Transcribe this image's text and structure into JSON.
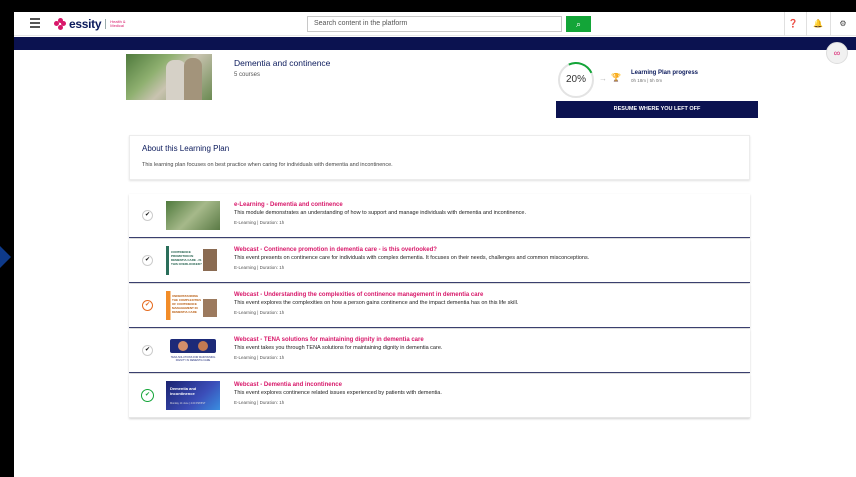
{
  "topbar": {
    "brand": "essity",
    "brand_sub": "Health & Medical",
    "search_placeholder": "Search content in the platform",
    "icons": [
      "hamburger-icon",
      "search-icon",
      "help-icon",
      "bell-icon",
      "gear-icon"
    ]
  },
  "plan": {
    "title": "Dementia and continence",
    "course_count": "5 courses",
    "progress_percent": "20%",
    "progress_fraction": 0.2,
    "progress_label": "Learning Plan progress",
    "progress_time": "0h 18m | 5h 0m",
    "resume_label": "RESUME WHERE YOU LEFT OFF"
  },
  "about": {
    "title": "About this Learning Plan",
    "text": "This learning plan focuses on best practice when caring for individuals with dementia and incontinence."
  },
  "courses": [
    {
      "title": "e-Learning - Dementia and continence",
      "desc": "This module demonstrates an understanding of how to support and manage individuals with dementia and incontinence.",
      "meta": "E-Learning  |  Duration: 1h",
      "status": "completed"
    },
    {
      "title": "Webcast - Continence promotion in dementia care - is this overlooked?",
      "desc": "This event presents on continence care for individuals with complex dementia. It focuses on their needs, challenges and common misconceptions.",
      "meta": "E-Learning  |  Duration: 1h",
      "status": "completed",
      "thumb_text": "CONTINENCE PROMOTION IN DEMENTIA CARE - IS THIS OVERLOOKED?"
    },
    {
      "title": "Webcast - Understanding the complexities of continence management in dementia care",
      "desc": "This event explores the complexities on how a person gains continence and the impact dementia has on this life skill.",
      "meta": "E-Learning  |  Duration: 1h",
      "status": "in-progress",
      "thumb_text": "UNDERSTANDING THE COMPLEXITIES OF CONTINENCE MANAGEMENT IN DEMENTIA CARE"
    },
    {
      "title": "Webcast - TENA solutions for maintaining dignity in dementia care",
      "desc": "This event takes you through TENA solutions for maintaining dignity in dementia care.",
      "meta": "E-Learning  |  Duration: 1h",
      "status": "completed",
      "thumb_text": "TENA SOLUTIONS FOR MAINTAINING DIGNITY IN DEMENTIA CARE"
    },
    {
      "title": "Webcast - Dementia and incontinence",
      "desc": "This event explores continence related issues experienced by patients with dementia.",
      "meta": "E-Learning  |  Duration: 1h",
      "status": "current",
      "thumb_text": "Dementia and incontinence",
      "thumb_sub": "Monday 14 June | 4.00 PM BST"
    }
  ],
  "colors": {
    "accent": "#d8186a",
    "navy": "#0b1250",
    "green": "#13a538",
    "orange": "#e56b1f"
  }
}
